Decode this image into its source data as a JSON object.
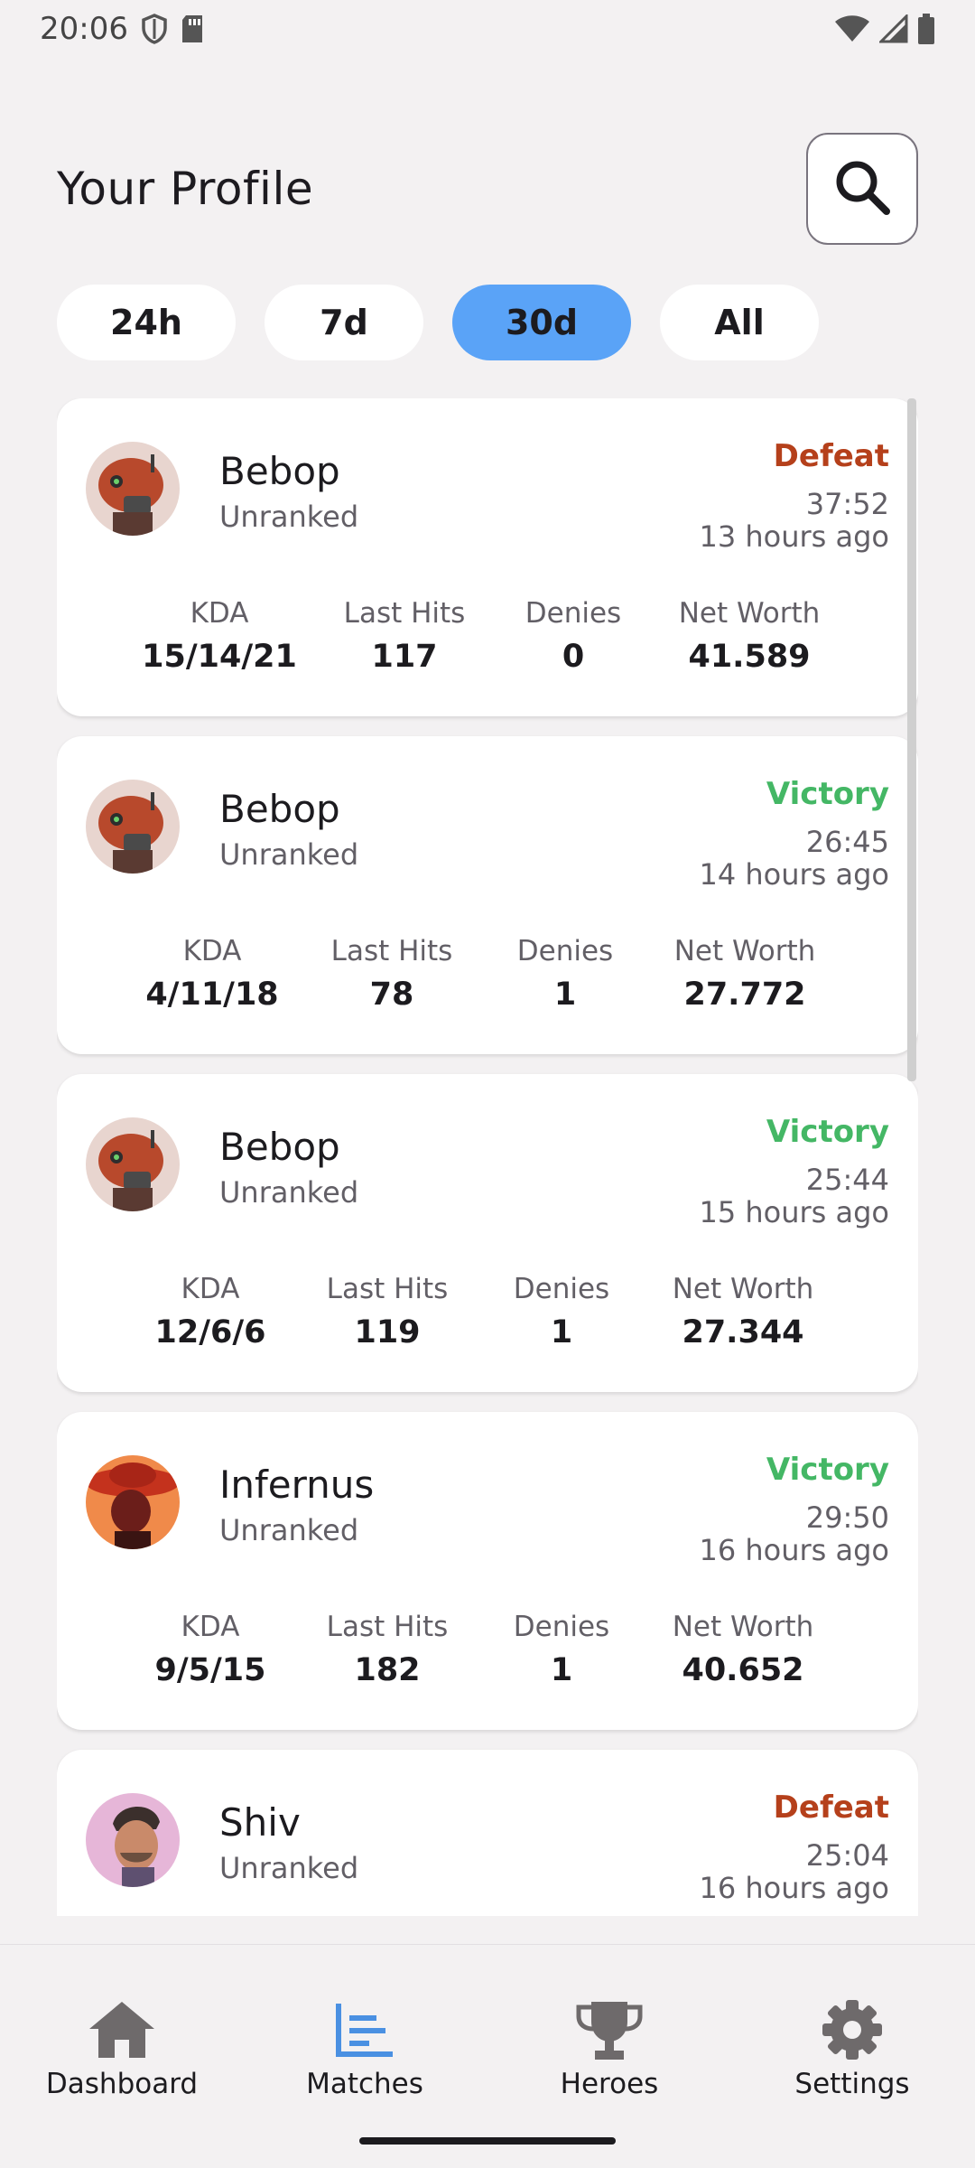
{
  "status_bar": {
    "time": "20:06"
  },
  "header": {
    "title": "Your Profile"
  },
  "filters": [
    {
      "label": "24h",
      "selected": false
    },
    {
      "label": "7d",
      "selected": false
    },
    {
      "label": "30d",
      "selected": true
    },
    {
      "label": "All",
      "selected": false
    }
  ],
  "stat_labels": {
    "kda": "KDA",
    "last_hits": "Last Hits",
    "denies": "Denies",
    "net_worth": "Net Worth"
  },
  "matches": [
    {
      "hero": "Bebop",
      "rank": "Unranked",
      "result": "Defeat",
      "duration": "37:52",
      "ago": "13 hours ago",
      "kda": "15/14/21",
      "last_hits": "117",
      "denies": "0",
      "net_worth": "41.589",
      "avatar": "bebop"
    },
    {
      "hero": "Bebop",
      "rank": "Unranked",
      "result": "Victory",
      "duration": "26:45",
      "ago": "14 hours ago",
      "kda": "4/11/18",
      "last_hits": "78",
      "denies": "1",
      "net_worth": "27.772",
      "avatar": "bebop"
    },
    {
      "hero": "Bebop",
      "rank": "Unranked",
      "result": "Victory",
      "duration": "25:44",
      "ago": "15 hours ago",
      "kda": "12/6/6",
      "last_hits": "119",
      "denies": "1",
      "net_worth": "27.344",
      "avatar": "bebop"
    },
    {
      "hero": "Infernus",
      "rank": "Unranked",
      "result": "Victory",
      "duration": "29:50",
      "ago": "16 hours ago",
      "kda": "9/5/15",
      "last_hits": "182",
      "denies": "1",
      "net_worth": "40.652",
      "avatar": "infernus"
    },
    {
      "hero": "Shiv",
      "rank": "Unranked",
      "result": "Defeat",
      "duration": "25:04",
      "ago": "16 hours ago",
      "kda": "",
      "last_hits": "",
      "denies": "",
      "net_worth": "",
      "avatar": "shiv"
    }
  ],
  "nav": [
    {
      "label": "Dashboard",
      "icon": "home-icon",
      "active": false
    },
    {
      "label": "Matches",
      "icon": "chart-icon",
      "active": true
    },
    {
      "label": "Heroes",
      "icon": "trophy-icon",
      "active": false
    },
    {
      "label": "Settings",
      "icon": "gear-icon",
      "active": false
    }
  ],
  "colors": {
    "accent": "#5aa3f7",
    "victory": "#44b765",
    "defeat": "#b5401b",
    "nav_active": "#4a90e2",
    "nav_inactive": "#6e6a6b"
  }
}
